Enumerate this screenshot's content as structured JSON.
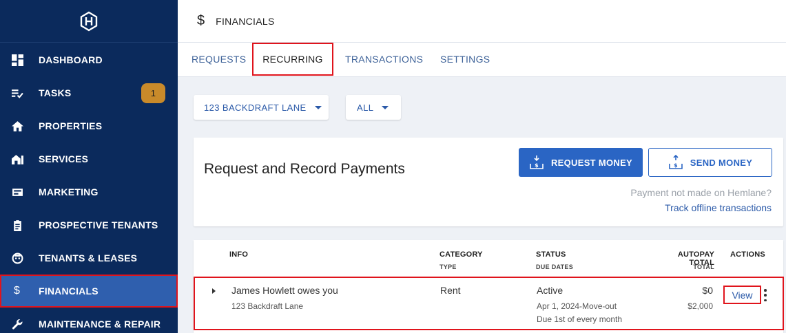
{
  "sidebar": {
    "items": [
      {
        "label": "DASHBOARD",
        "icon": "dashboard-icon"
      },
      {
        "label": "TASKS",
        "icon": "tasks-icon",
        "badge": "1"
      },
      {
        "label": "PROPERTIES",
        "icon": "home-icon"
      },
      {
        "label": "SERVICES",
        "icon": "services-icon"
      },
      {
        "label": "MARKETING",
        "icon": "marketing-icon"
      },
      {
        "label": "PROSPECTIVE TENANTS",
        "icon": "clipboard-icon"
      },
      {
        "label": "TENANTS & LEASES",
        "icon": "tenant-face-icon"
      },
      {
        "label": "FINANCIALS",
        "icon": "dollar-icon",
        "active": true
      },
      {
        "label": "MAINTENANCE & REPAIR",
        "icon": "wrench-icon"
      }
    ]
  },
  "header": {
    "icon": "$",
    "title": "FINANCIALS"
  },
  "tabs": [
    {
      "label": "REQUESTS"
    },
    {
      "label": "RECURRING",
      "active": true
    },
    {
      "label": "TRANSACTIONS"
    },
    {
      "label": "SETTINGS"
    }
  ],
  "filters": {
    "property": "123 BACKDRAFT LANE",
    "status": "ALL"
  },
  "payments_card": {
    "heading": "Request and Record Payments",
    "request_button": "REQUEST MONEY",
    "send_button": "SEND MONEY",
    "note": "Payment not made on Hemlane?",
    "link": "Track offline transactions"
  },
  "table": {
    "headers": {
      "info": "INFO",
      "category": "CATEGORY",
      "category_sub": "TYPE",
      "status": "STATUS",
      "status_sub": "DUE DATES",
      "autopay": "AUTOPAY TOTAL",
      "autopay_sub": "TOTAL",
      "actions": "ACTIONS"
    },
    "rows": [
      {
        "title": "James Howlett owes you",
        "address": "123 Backdraft Lane",
        "category": "Rent",
        "status": "Active",
        "dates": "Apr 1, 2024-Move-out",
        "due": "Due 1st of every month",
        "autopay": "$0",
        "total": "$2,000",
        "action": "View"
      }
    ]
  },
  "colors": {
    "sidebar": "#0b2a5c",
    "active_nav": "#2f5fae",
    "primary": "#2a65c4",
    "badge": "#c98a2a",
    "highlight": "#e0141c"
  }
}
